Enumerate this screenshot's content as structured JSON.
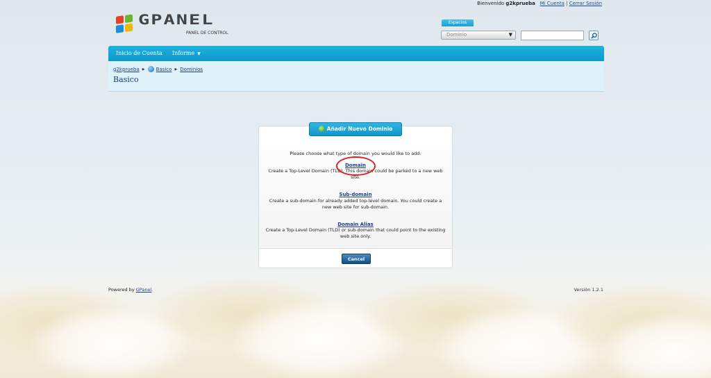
{
  "topbar": {
    "welcome": "Bienvenido",
    "username": "g2kprueba",
    "account_link": "Mi Cuenta",
    "separator": "|",
    "logout_link": "Cerrar Sesión"
  },
  "logo": {
    "text": "GPANEL",
    "subtitle": "PANEL DE CONTROL"
  },
  "spaces": {
    "tab_label": "Espacios",
    "select_value": "Dominio",
    "search_value": ""
  },
  "nav": {
    "items": [
      {
        "label": "Inicio de Cuenta"
      },
      {
        "label": "Informe"
      }
    ]
  },
  "breadcrumb": {
    "items": [
      "g2kprueba",
      "Basico",
      "Dominios"
    ]
  },
  "page": {
    "title": "Basico"
  },
  "dialog": {
    "title": "Añadir Nuevo Dominio",
    "prompt": "Please choose what type of domain you would like to add:",
    "options": [
      {
        "link": "Domain",
        "description": "Create a Top-Level Domain (TLD). This domain could be parked to a new web site."
      },
      {
        "link": "Sub-domain",
        "description": "Create a sub-domain for already added top-level domain. You could create a new web site for sub-domain."
      },
      {
        "link": "Domain Alias",
        "description": "Create a Top-Level Domain (TLD) or sub-domain that could point to the existing web site only."
      }
    ],
    "cancel_label": "Cancel"
  },
  "footer": {
    "powered_prefix": "Powered by",
    "powered_link": "GPanel",
    "powered_suffix": ".",
    "version": "Versión 1.2.1"
  },
  "colors": {
    "nav_blue": "#0d98c9",
    "link_blue": "#1a3f8a",
    "highlight_red": "#dd2222"
  }
}
